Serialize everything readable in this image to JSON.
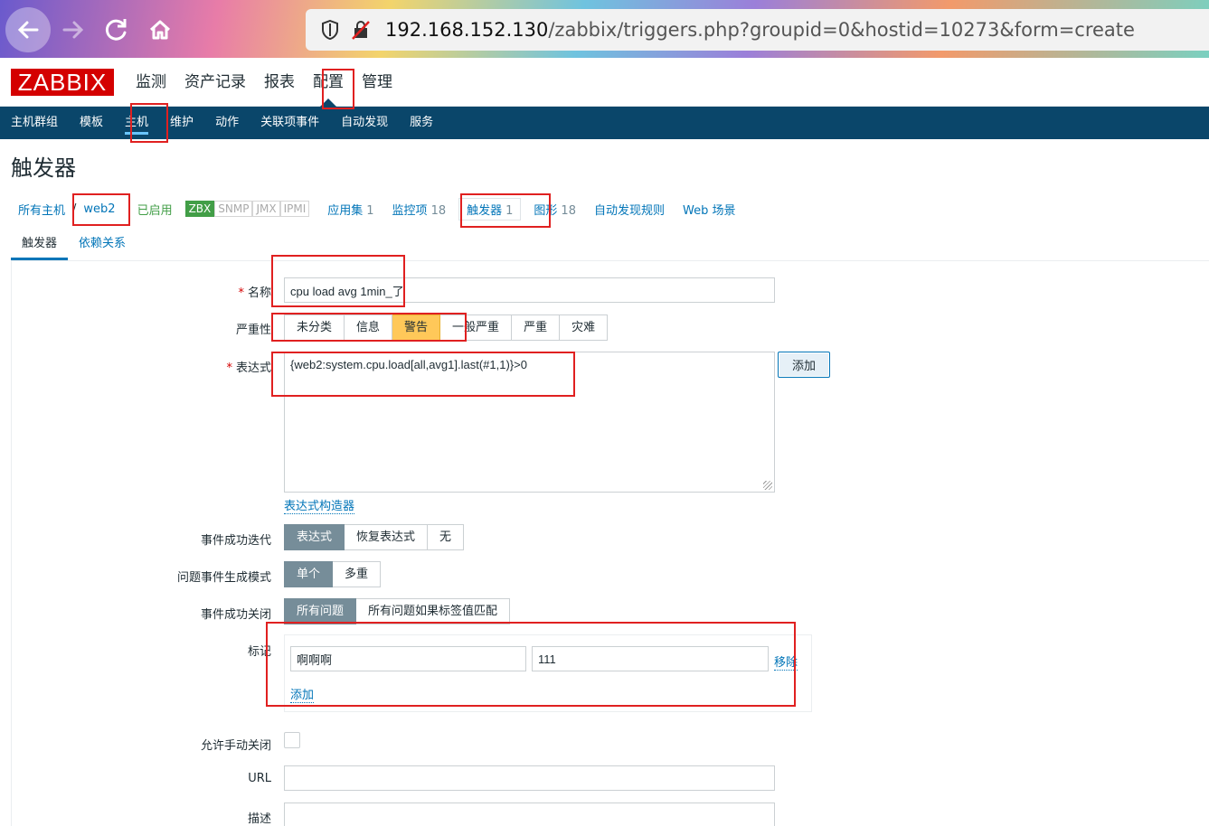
{
  "browser": {
    "url_host": "192.168.152.130",
    "url_path": "/zabbix/triggers.php?groupid=0&hostid=10273&form=create"
  },
  "header": {
    "logo": "ZABBIX",
    "menu": [
      "监测",
      "资产记录",
      "报表",
      "配置",
      "管理"
    ],
    "active_menu": "配置"
  },
  "subnav": {
    "items": [
      "主机群组",
      "模板",
      "主机",
      "维护",
      "动作",
      "关联项事件",
      "自动发现",
      "服务"
    ],
    "active": "主机"
  },
  "page_title": "触发器",
  "host_nav": {
    "all_hosts": "所有主机",
    "separator": "/",
    "host": "web2",
    "status": "已启用",
    "tags": [
      "ZBX",
      "SNMP",
      "JMX",
      "IPMI"
    ],
    "apps": {
      "label": "应用集",
      "count": "1"
    },
    "items": {
      "label": "监控项",
      "count": "18"
    },
    "triggers": {
      "label": "触发器",
      "count": "1"
    },
    "graphs": {
      "label": "图形",
      "count": "18"
    },
    "discovery": "自动发现规则",
    "web": "Web 场景"
  },
  "form_tabs": [
    "触发器",
    "依赖关系"
  ],
  "form": {
    "name_label": "名称",
    "name_value": "cpu load avg 1min_了",
    "severity_label": "严重性",
    "severity_options": [
      "未分类",
      "信息",
      "警告",
      "一般严重",
      "严重",
      "灾难"
    ],
    "severity_selected": "警告",
    "expr_label": "表达式",
    "expr_value": "{web2:system.cpu.load[all,avg1].last(#1,1)}>0",
    "add_button": "添加",
    "expr_builder": "表达式构造器",
    "ok_event_gen_label": "事件成功迭代",
    "ok_event_gen_options": [
      "表达式",
      "恢复表达式",
      "无"
    ],
    "problem_mode_label": "问题事件生成模式",
    "problem_mode_options": [
      "单个",
      "多重"
    ],
    "ok_close_label": "事件成功关闭",
    "ok_close_options": [
      "所有问题",
      "所有问题如果标签值匹配"
    ],
    "tags_label": "标记",
    "tag_name": "啊啊啊",
    "tag_value": "111",
    "tag_remove": "移除",
    "tag_add": "添加",
    "manual_close_label": "允许手动关闭",
    "url_label": "URL",
    "desc_label": "描述"
  },
  "colors": {
    "nav_bg": "#0a466a",
    "link": "#0275b8",
    "logo": "#d40000",
    "warning": "#ffc859",
    "annotation": "#e02020"
  }
}
